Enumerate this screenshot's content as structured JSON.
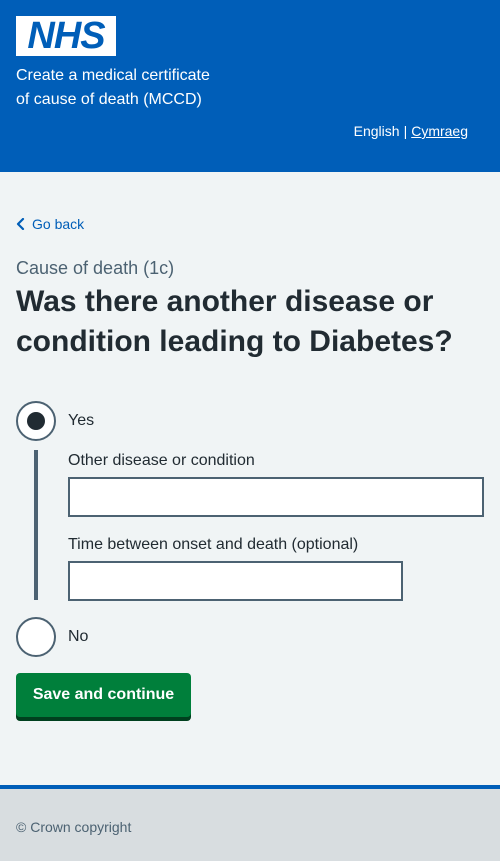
{
  "header": {
    "logo_text": "NHS",
    "service_name_line1": "Create a medical certificate",
    "service_name_line2": "of cause of death (MCCD)",
    "language": {
      "current": "English",
      "separator": "|",
      "alternate": "Cymraeg"
    }
  },
  "nav": {
    "back_label": "Go back"
  },
  "main": {
    "caption": "Cause of death (1c)",
    "heading": "Was there another disease or condition leading to Diabetes?",
    "radios": [
      {
        "label": "Yes",
        "checked": true
      },
      {
        "label": "No",
        "checked": false
      }
    ],
    "conditional": {
      "disease_label": "Other disease or condition",
      "disease_value": "",
      "time_label": "Time between onset and death (optional)",
      "time_value": ""
    },
    "submit_label": "Save and continue"
  },
  "footer": {
    "copyright": "© Crown copyright"
  },
  "colors": {
    "nhs_blue": "#005eb8",
    "button_green": "#007f3b",
    "text": "#212b32",
    "secondary_text": "#4c6272",
    "background": "#f0f4f5",
    "footer_bg": "#d8dde0"
  }
}
